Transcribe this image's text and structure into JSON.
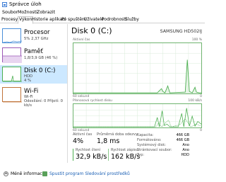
{
  "window": {
    "title": "Správce úloh"
  },
  "menu": [
    "Soubor",
    "Možnosti",
    "Zobrazit"
  ],
  "tabs": [
    "Procesy",
    "Výkon",
    "Historie aplikací",
    "Po spuštění",
    "Uživatelé",
    "Podrobnosti",
    "Služby"
  ],
  "active_tab": "Výkon",
  "sidebar": [
    {
      "name": "Procesor",
      "sub1": "5% 2,37 GHz",
      "sub2": ""
    },
    {
      "name": "Paměť",
      "sub1": "1,8/3,9 GB (46 %)",
      "sub2": ""
    },
    {
      "name": "Disk 0 (C:)",
      "sub1": "HDD",
      "sub2": "4 %"
    },
    {
      "name": "Wi-Fi",
      "sub1": "Wi-Fi",
      "sub2": "Odesílání: 0 Přijetí: 0 kb/s"
    }
  ],
  "disk": {
    "title": "Disk 0 (C:)",
    "model": "SAMSUNG HD502IJ",
    "active_time_label": "Aktivní čas",
    "pct_max": "100 %",
    "seconds_label": "60 sekund",
    "zero": "0",
    "transfer_label": "Přenosová rychlost disku",
    "transfer_max": "100 kB/s"
  },
  "stats": {
    "active_time_label": "Aktivní čas",
    "active_time_value": "4%",
    "avg_response_label": "Průměrná doba odezvy",
    "avg_response_value": "1,8 ms",
    "read_label": "Rychlost čtení",
    "read_value": "32,9 kB/s",
    "write_label": "Rychlost zápisu",
    "write_value": "162 kB/s"
  },
  "properties": [
    {
      "label": "Kapacita:",
      "value": "466 GB"
    },
    {
      "label": "Formátováno:",
      "value": "466 GB"
    },
    {
      "label": "Systémový disk:",
      "value": "Ano"
    },
    {
      "label": "Stránkovací soubor:",
      "value": "Ano"
    },
    {
      "label": "Typ:",
      "value": "HDD"
    }
  ],
  "footer": {
    "fewer_details": "Méně informací",
    "open_monitor": "Spustit program Sledování prostředků"
  },
  "colors": {
    "accent": "#4caf50",
    "selection": "#cce8ff",
    "link": "#1a5fb4"
  }
}
